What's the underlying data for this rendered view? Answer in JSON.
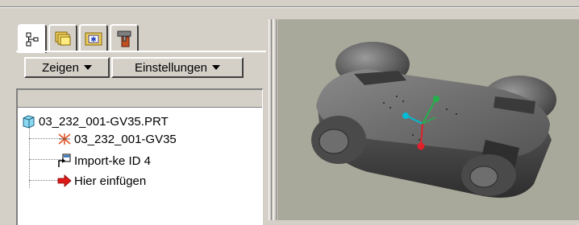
{
  "toolbar": {
    "show_label": "Zeigen",
    "settings_label": "Einstellungen"
  },
  "tabs": [
    {
      "icon": "model-tree-icon",
      "active": true
    },
    {
      "icon": "folder-browser-icon",
      "active": false
    },
    {
      "icon": "favorites-icon",
      "active": false
    },
    {
      "icon": "tools-icon",
      "active": false
    }
  ],
  "tree": {
    "root": {
      "label": "03_232_001-GV35.PRT",
      "icon": "part-icon"
    },
    "items": [
      {
        "label": "03_232_001-GV35",
        "icon": "coordinate-system-icon"
      },
      {
        "label": "Import-ke ID 4",
        "icon": "import-feature-icon"
      },
      {
        "label": "Hier einfügen",
        "icon": "insert-here-arrow-icon"
      }
    ]
  },
  "viewport": {
    "background": "#a9a99b",
    "axis_colors": {
      "x": "#00bcd4",
      "y": "#22b14c",
      "z": "#e0202a"
    }
  }
}
